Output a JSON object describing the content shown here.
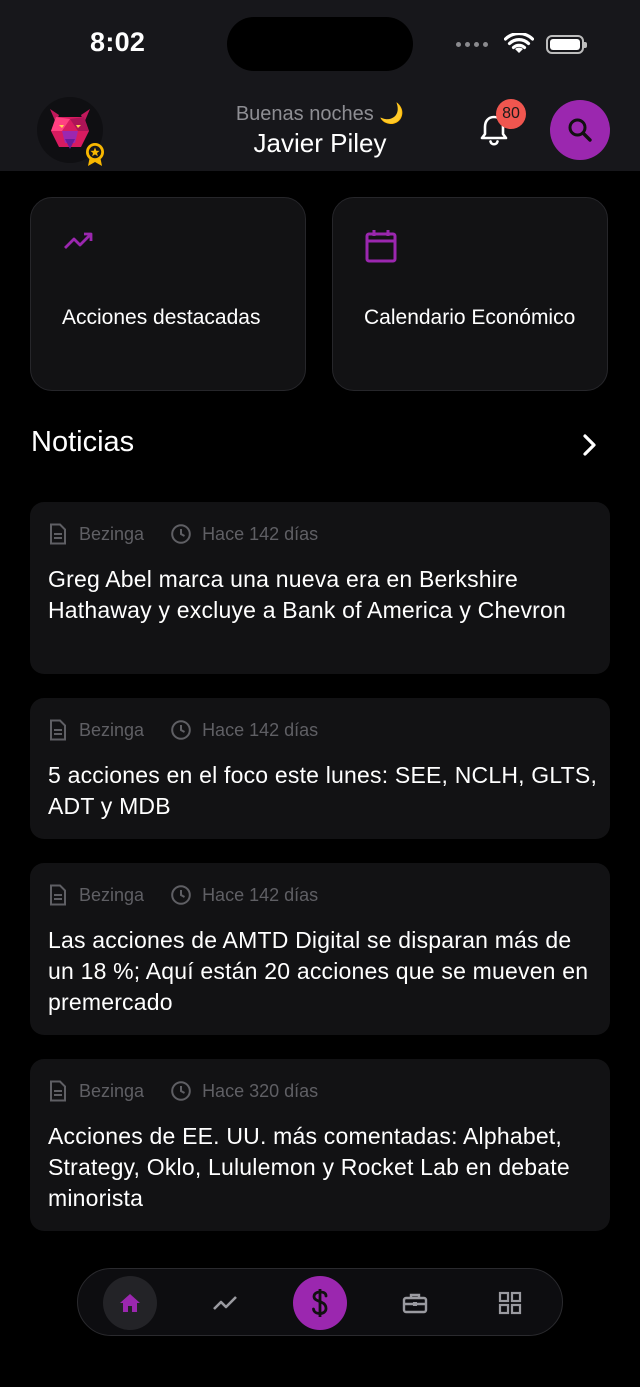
{
  "status_bar": {
    "time": "8:02"
  },
  "header": {
    "greeting": "Buenas noches 🌙",
    "user_name": "Javier Piley",
    "notification_count": "80",
    "avatar_icon": "bear-avatar-icon",
    "badge_icon": "award-badge-icon",
    "accent_color": "#9b27af",
    "notification_color": "#f0564f"
  },
  "quick_cards": [
    {
      "label": "Acciones destacadas",
      "icon": "trending-up-icon"
    },
    {
      "label": "Calendario Económico",
      "icon": "calendar-icon"
    }
  ],
  "news_section": {
    "title": "Noticias",
    "items": [
      {
        "source": "Bezinga",
        "time_ago": "Hace 142 días",
        "headline": "Greg Abel marca una nueva era en Berkshire Hathaway y excluye a Bank of America y Chevron"
      },
      {
        "source": "Bezinga",
        "time_ago": "Hace 142 días",
        "headline": "5 acciones en el foco este lunes: SEE, NCLH, GLTS, ADT y MDB"
      },
      {
        "source": "Bezinga",
        "time_ago": "Hace 142 días",
        "headline": "Las acciones de AMTD Digital se disparan más de un 18 %; Aquí están 20 acciones que se mueven en premercado"
      },
      {
        "source": "Bezinga",
        "time_ago": "Hace 320 días",
        "headline": "Acciones de EE. UU. más comentadas: Alphabet, Strategy, Oklo, Lululemon y Rocket Lab en debate minorista"
      }
    ]
  },
  "bottom_nav": {
    "items": [
      "home-icon",
      "chart-icon",
      "dollar-icon",
      "briefcase-icon",
      "grid-icon"
    ],
    "active": "home-icon"
  }
}
